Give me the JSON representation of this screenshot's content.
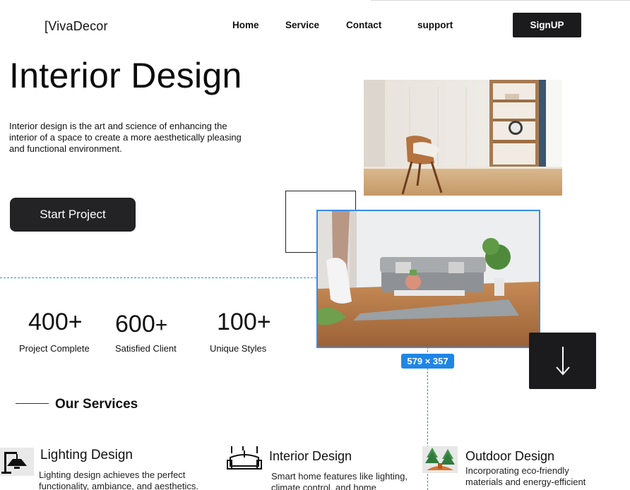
{
  "brand": {
    "logo": "[VivaDecor"
  },
  "nav": {
    "items": [
      "Home",
      "Service",
      "Contact",
      "support"
    ],
    "signup": "SignUP"
  },
  "hero": {
    "title": "Interior Design",
    "description": "Interior design is the art and science of enhancing the interior of a space to create a more aesthetically pleasing and functional environment.",
    "cta": "Start Project"
  },
  "stats": [
    {
      "number": "400",
      "suffix": "+",
      "label": "Project Complete"
    },
    {
      "number": "600",
      "suffix": "+",
      "label": "Satisfied Client"
    },
    {
      "number": "100",
      "suffix": "+",
      "label": "Unique Styles"
    }
  ],
  "selection": {
    "size_label": "579 × 357"
  },
  "services": {
    "heading": "Our Services",
    "items": [
      {
        "icon": "lamp-icon",
        "title": "Lighting Design",
        "description": "Lighting design achieves the perfect functionality, ambiance, and aesthetics."
      },
      {
        "icon": "sofa-icon",
        "title": "Interior Design",
        "description": "Smart home features like lighting, climate control, and home"
      },
      {
        "icon": "trees-icon",
        "title": "Outdoor Design",
        "description": "Incorporating eco-friendly materials and energy-efficient"
      }
    ]
  },
  "colors": {
    "accent": "#1f86e5",
    "dark": "#1b1b1d"
  }
}
